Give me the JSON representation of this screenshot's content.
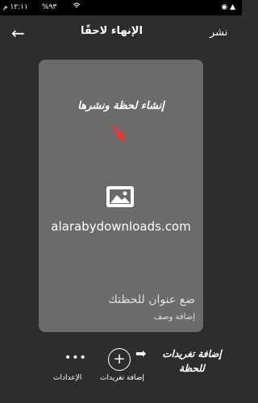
{
  "status_bar": {
    "time": "١٢:١١ م",
    "battery": "%٩٣",
    "wifi": "⚡",
    "icons": "◉ ▲"
  },
  "app_bar": {
    "publish": "نشر",
    "title": "الإنهاء لاحقًا"
  },
  "card": {
    "heading": "إنشاء لحظة ونشرها",
    "watermark": "alarabydownloads.com",
    "title_placeholder": "ضع عنوان للحظتك",
    "description_placeholder": "إضافة وصف"
  },
  "annotation": {
    "line1": "إضافة تغريدات",
    "line2": "للحظة"
  },
  "bottom": {
    "add_tweets_label": "إضافة تغريدات",
    "settings_label": "الإعدادات"
  },
  "colors": {
    "background": "#2d2d2d",
    "card": "#6b6b6b",
    "arrow": "#e53935"
  }
}
